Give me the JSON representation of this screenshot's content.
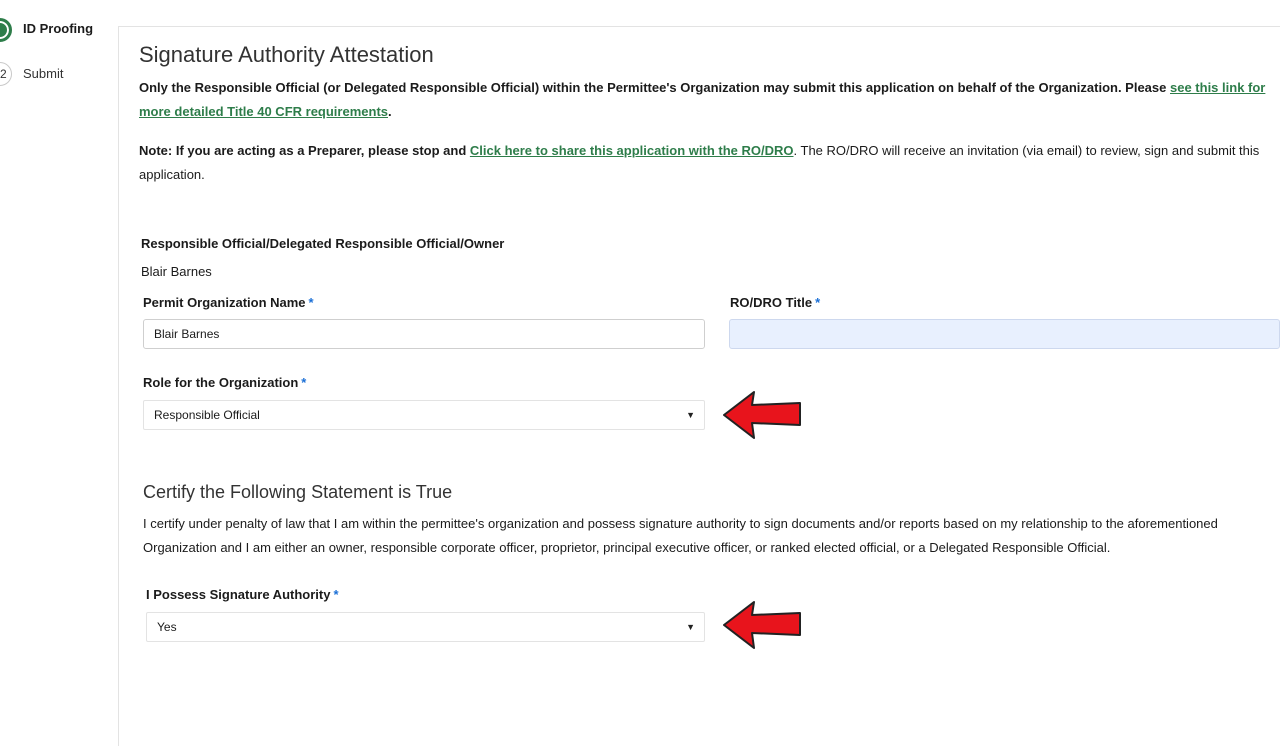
{
  "stepper": {
    "steps": [
      {
        "number": "1",
        "label": "ID Proofing",
        "active": true
      },
      {
        "number": "2",
        "label": "Submit",
        "active": false
      }
    ]
  },
  "page": {
    "title": "Signature Authority Attestation",
    "intro": {
      "text": "Only the Responsible Official (or Delegated Responsible Official) within the Permittee's Organization may submit this application on behalf of the Organization. Please ",
      "link": "see this link for more detailed Title 40 CFR requirements",
      "end": "."
    },
    "note": {
      "prefix": "Note: If you are acting as a Preparer, please stop and ",
      "link": "Click here to share this application with the RO/DRO",
      "suffix": ". The RO/DRO will receive an invitation (via email) to review, sign and submit this application."
    }
  },
  "form": {
    "official_label": "Responsible Official/Delegated Responsible Official/Owner",
    "official_value": "Blair Barnes",
    "org_name_label": "Permit Organization Name",
    "org_name_value": "Blair Barnes",
    "title_label": "RO/DRO Title",
    "title_value": "",
    "role_label": "Role for the Organization",
    "role_value": "Responsible Official",
    "required_mark": "*"
  },
  "certify": {
    "heading": "Certify the Following Statement is True",
    "statement": "I certify under penalty of law that I am within the permittee's organization and possess signature authority to sign documents and/or reports based on my relationship to the aforementioned Organization and I am either an owner, responsible corporate officer, proprietor, principal executive officer, or ranked elected official, or a Delegated Responsible Official.",
    "authority_label": "I Possess Signature Authority",
    "authority_value": "Yes"
  },
  "colors": {
    "accent_green": "#2e7d4a",
    "required_blue": "#1a6fd6",
    "arrow_red": "#e8141c"
  },
  "icons": {
    "dropdown": "caret-down-icon",
    "annotation": "red-arrow-left-icon"
  }
}
